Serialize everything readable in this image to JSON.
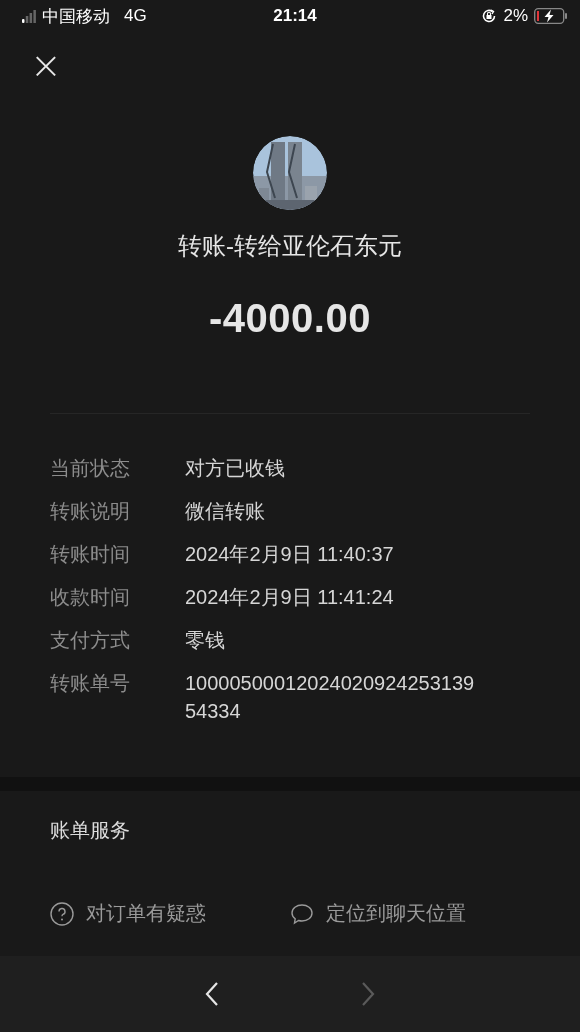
{
  "status_bar": {
    "carrier": "中国移动",
    "network": "4G",
    "time": "21:14",
    "battery": "2%"
  },
  "close": {
    "label": "×"
  },
  "header": {
    "title": "转账-转给亚伦石东元",
    "amount": "-4000.00"
  },
  "details": [
    {
      "label": "当前状态",
      "value": "对方已收钱"
    },
    {
      "label": "转账说明",
      "value": "微信转账"
    },
    {
      "label": "转账时间",
      "value": "2024年2月9日 11:40:37"
    },
    {
      "label": "收款时间",
      "value": "2024年2月9日 11:41:24"
    },
    {
      "label": "支付方式",
      "value": "零钱"
    },
    {
      "label": "转账单号",
      "value": "1000050001202402092425313954334"
    }
  ],
  "services": {
    "title": "账单服务",
    "actions": [
      {
        "kind": "question",
        "label": "对订单有疑惑"
      },
      {
        "kind": "chat",
        "label": "定位到聊天位置"
      }
    ]
  },
  "toolbar": {
    "back": {
      "disabled": false
    },
    "forward": {
      "disabled": true
    }
  }
}
